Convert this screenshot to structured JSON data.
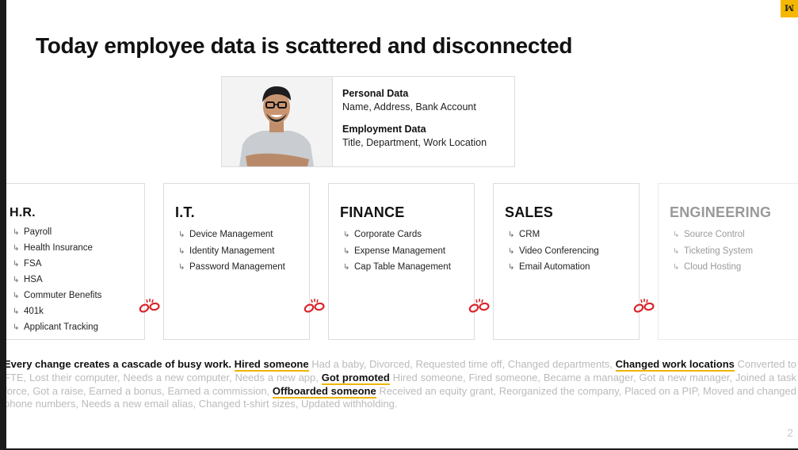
{
  "title": "Today employee data is scattered and disconnected",
  "profile": {
    "personal_heading": "Personal Data",
    "personal_fields": "Name, Address, Bank Account",
    "employment_heading": "Employment Data",
    "employment_fields": "Title, Department, Work Location"
  },
  "departments": {
    "hr": {
      "title": "H.R.",
      "items": [
        "Payroll",
        "Health Insurance",
        "FSA",
        "HSA",
        "Commuter Benefits",
        "401k",
        "Applicant Tracking"
      ]
    },
    "it": {
      "title": "I.T.",
      "items": [
        "Device Management",
        "Identity  Management",
        "Password Management"
      ]
    },
    "finance": {
      "title": "FINANCE",
      "items": [
        "Corporate Cards",
        "Expense Management",
        "Cap Table Management"
      ]
    },
    "sales": {
      "title": "SALES",
      "items": [
        "CRM",
        "Video Conferencing",
        "Email Automation"
      ]
    },
    "engineering": {
      "title": "ENGINEERING",
      "items": [
        "Source Control",
        "Ticketing System",
        "Cloud Hosting"
      ]
    }
  },
  "bullet_glyph": "↳",
  "paragraph": {
    "lead": "Every change creates a cascade of busy work.",
    "h1": "Hired someone",
    "t1": " Had a baby, Divorced, Requested time off, Changed departments, ",
    "h2": "Changed work locations",
    "t2": " Converted to FTE, Lost their computer, Needs a new computer, Needs a new app, ",
    "h3": "Got promoted",
    "t3": " Hired someone, Fired someone, Became a manager, Got a new manager, Joined a task force, Got a raise, Earned a bonus, Earned a commission, ",
    "h4": "Offboarded someone",
    "t4": " Received an equity grant, Reorganized the company, Placed on a PIP, Moved and changed phone numbers, Needs a new email alias, Changed t-shirt sizes, Updated withholding."
  },
  "page_number": "2",
  "colors": {
    "accent": "#f5b700",
    "link_red": "#d9262c",
    "highlight_underline": "#f0b400"
  }
}
